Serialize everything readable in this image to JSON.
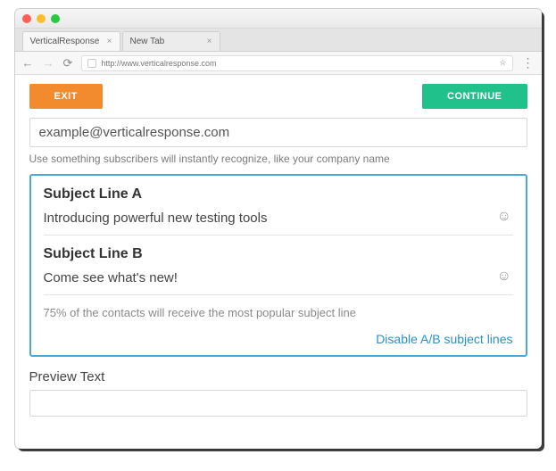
{
  "browser": {
    "tabs": [
      {
        "label": "VerticalResponse",
        "active": true
      },
      {
        "label": "New Tab",
        "active": false
      }
    ],
    "url": "http://www.verticalresponse.com"
  },
  "topbar": {
    "exit_label": "EXIT",
    "continue_label": "CONTINUE"
  },
  "from": {
    "value": "example@verticalresponse.com",
    "help": "Use something subscribers will instantly recognize, like your company name"
  },
  "ab": {
    "label_a": "Subject Line A",
    "value_a": "Introducing powerful new testing tools",
    "label_b": "Subject Line B",
    "value_b": "Come see what's new!",
    "note": "75% of the contacts will receive the most popular subject line",
    "disable_link": "Disable A/B subject lines"
  },
  "preview": {
    "label": "Preview Text"
  }
}
